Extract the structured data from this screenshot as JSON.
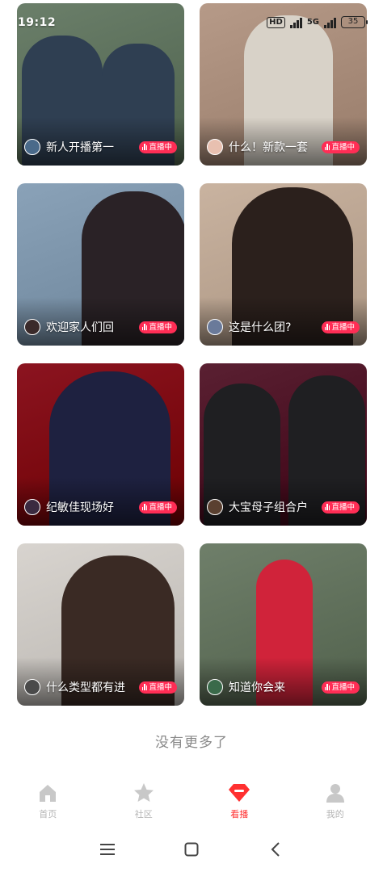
{
  "status_bar": {
    "time": "19:12",
    "hd": "HD",
    "network": "5G",
    "battery": "35"
  },
  "cards": [
    {
      "title": "新人开播第一",
      "badge": "直播中",
      "bg": "#6b7f6a",
      "figure": "#2f3f52",
      "avatar": "#4a6a8a"
    },
    {
      "title": "什么！新款一套",
      "badge": "直播中",
      "bg": "#b69a88",
      "figure": "#d8d2c8",
      "avatar": "#e8c0b0"
    },
    {
      "title": "欢迎家人们回",
      "badge": "直播中",
      "bg": "#8aa2b8",
      "figure": "#2a2226",
      "avatar": "#3a2a2a"
    },
    {
      "title": "这是什么团?",
      "badge": "直播中",
      "bg": "#c9b3a0",
      "figure": "#2b201c",
      "avatar": "#6a7a9a"
    },
    {
      "title": "纪敏佳现场好",
      "badge": "直播中",
      "bg": "#8b1420",
      "figure": "#1e2140",
      "avatar": "#3a2a40"
    },
    {
      "title": "大宝母子组合户",
      "badge": "直播中",
      "bg": "#5a2032",
      "figure": "#1f1f22",
      "avatar": "#5a4030"
    },
    {
      "title": "什么类型都有进",
      "badge": "直播中",
      "bg": "#d8d4cf",
      "figure": "#3a2a24",
      "avatar": "#4a4a4a"
    },
    {
      "title": "知道你会来",
      "badge": "直播中",
      "bg": "#6f7f6a",
      "figure": "#d0233a",
      "avatar": "#3a6a4a"
    }
  ],
  "footer_text": "没有更多了",
  "nav": {
    "items": [
      {
        "label": "首页",
        "icon": "home-icon"
      },
      {
        "label": "社区",
        "icon": "star-icon"
      },
      {
        "label": "看播",
        "icon": "live-watch-icon"
      },
      {
        "label": "我的",
        "icon": "profile-icon"
      }
    ],
    "active_index": 2,
    "active_color": "#ff3030",
    "inactive_color": "#c8c8c8"
  },
  "colors": {
    "live_badge": "#ff2d55"
  }
}
